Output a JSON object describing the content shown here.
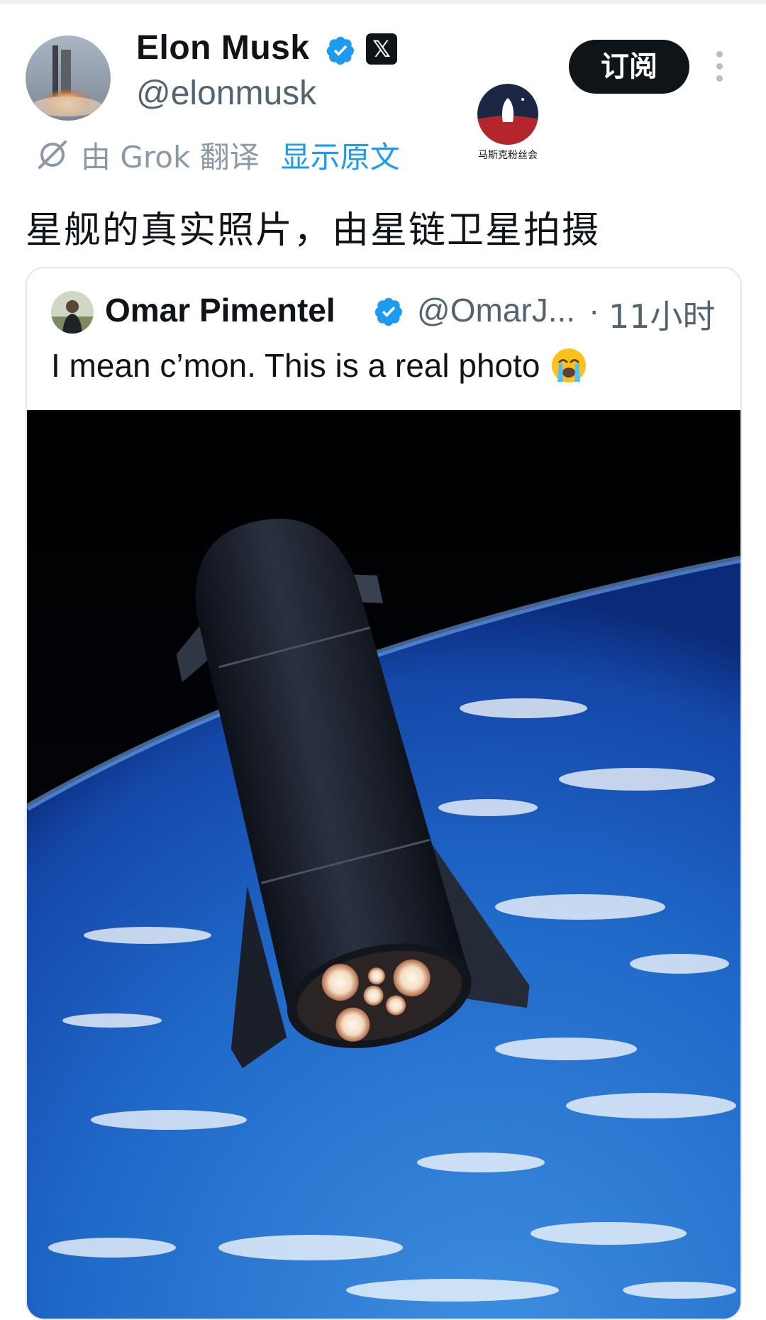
{
  "author": {
    "name": "Elon Musk",
    "handle": "@elonmusk",
    "x_badge": "𝕏",
    "subscribe_label": "订阅",
    "avatar_icon": "rocket-launch-avatar"
  },
  "watermark": {
    "text": "马斯克粉丝会",
    "icon": "rocket-on-planet-logo"
  },
  "translation": {
    "label": "由 Grok 翻译",
    "show_original": "显示原文",
    "icon": "grok-icon"
  },
  "post": {
    "text": "星舰的真实照片，由星链卫星拍摄"
  },
  "quoted": {
    "name": "Omar Pimentel",
    "handle": "@OmarJ...",
    "separator": "·",
    "time": "11小时",
    "text": "I mean c’mon. This is a real photo",
    "emoji": "loudly-crying-face",
    "image": "starship-over-earth-photo"
  },
  "colors": {
    "accent": "#1d9bf0",
    "text": "#0f1419",
    "muted": "#536471",
    "button_bg": "#0f1419"
  }
}
